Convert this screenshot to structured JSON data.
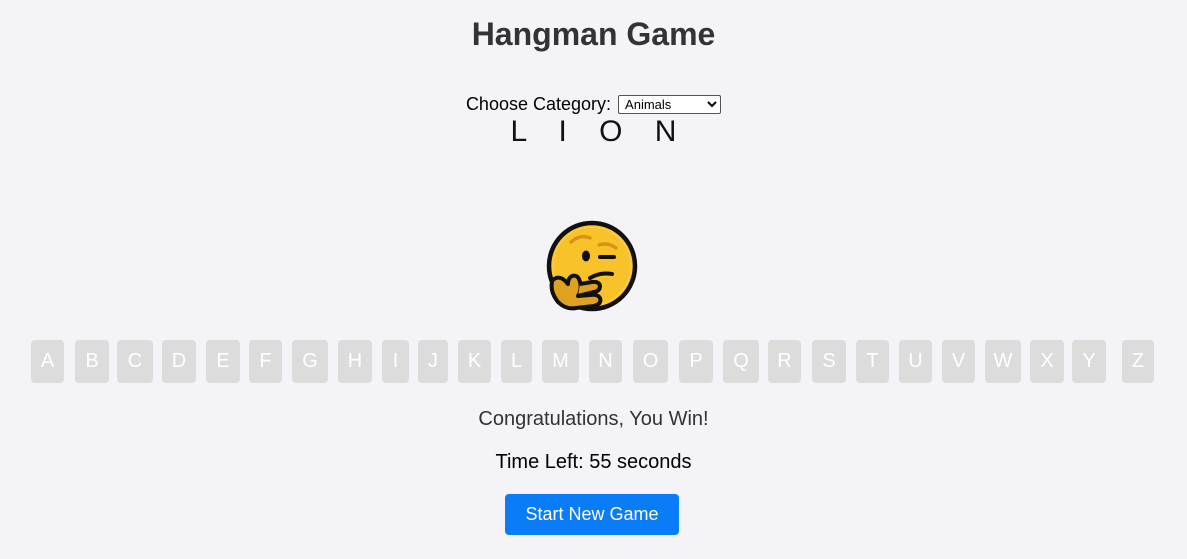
{
  "title": "Hangman Game",
  "category": {
    "label": "Choose Category:",
    "selected": "Animals",
    "options": [
      "Animals"
    ]
  },
  "word": "L I O N",
  "emoji": "thinking-face-icon",
  "letters": [
    "A",
    "B",
    "C",
    "D",
    "E",
    "F",
    "G",
    "H",
    "I",
    "J",
    "K",
    "L",
    "M",
    "N",
    "O",
    "P",
    "Q",
    "R",
    "S",
    "T",
    "U",
    "V",
    "W",
    "X",
    "Y",
    "Z"
  ],
  "status": {
    "message": "Congratulations, You Win!",
    "timer": "Time Left: 55 seconds"
  },
  "new_game_label": "Start New Game",
  "colors": {
    "background": "#f3f3f8",
    "letter_disabled": "#dcdcdc",
    "button": "#0a7cf8"
  }
}
